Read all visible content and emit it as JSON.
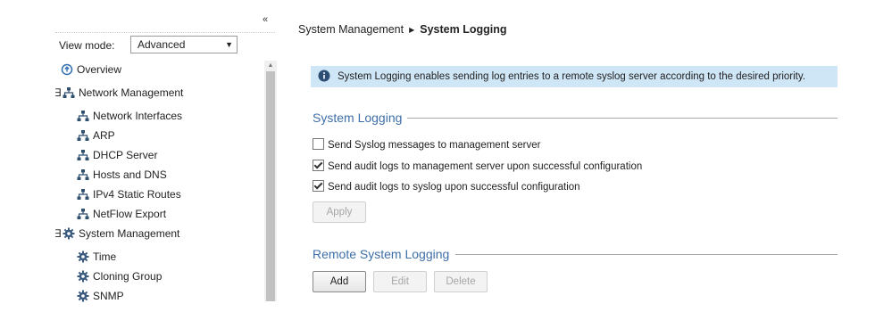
{
  "sidebar": {
    "collapse_glyph": "«",
    "view_mode_label": "View mode:",
    "view_mode_value": "Advanced",
    "tree": {
      "overview": "Overview",
      "network_management": "Network Management",
      "network_children": [
        "Network Interfaces",
        "ARP",
        "DHCP Server",
        "Hosts and DNS",
        "IPv4 Static Routes",
        "NetFlow Export"
      ],
      "system_management": "System Management",
      "system_children": [
        "Time",
        "Cloning Group",
        "SNMP"
      ]
    },
    "colors": {
      "network_icon": "#2f4f6f",
      "gear_icon": "#3a5a80"
    }
  },
  "breadcrumb": {
    "parent": "System Management",
    "current": "System Logging"
  },
  "info_banner": {
    "text": "System Logging enables sending log entries to a remote syslog server according to the desired priority.",
    "color": "#cfe6f7"
  },
  "system_logging": {
    "title": "System Logging",
    "options": [
      {
        "label": "Send Syslog messages to management server",
        "checked": false
      },
      {
        "label": "Send audit logs to management server upon successful configuration",
        "checked": true
      },
      {
        "label": "Send audit logs to syslog upon successful configuration",
        "checked": true
      }
    ],
    "apply_label": "Apply"
  },
  "remote_logging": {
    "title": "Remote System Logging",
    "add_label": "Add",
    "edit_label": "Edit",
    "delete_label": "Delete"
  },
  "accent_color": "#3f6fa8"
}
